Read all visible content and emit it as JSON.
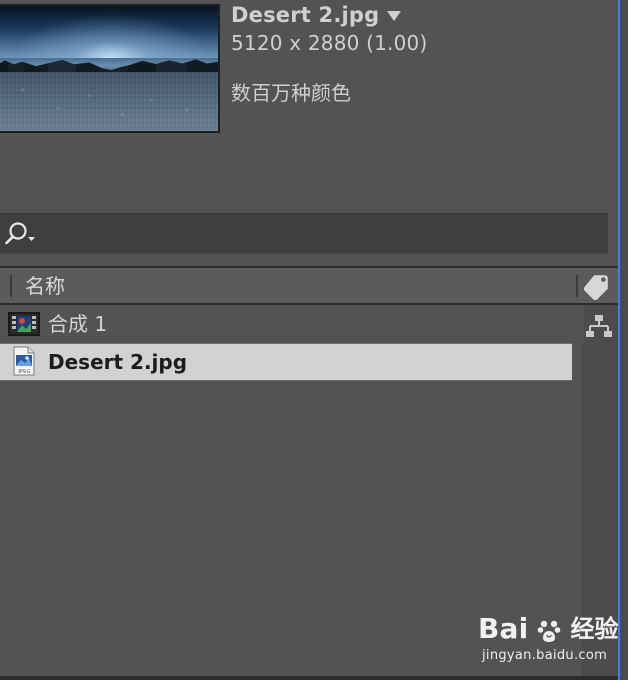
{
  "item": {
    "title": "Desert 2.jpg",
    "dimensions": "5120 x 2880 (1.00)",
    "color_depth": "数百万种颜色"
  },
  "search": {
    "value": "",
    "placeholder": ""
  },
  "columns": {
    "name": "名称"
  },
  "items": [
    {
      "label": "合成 1",
      "type": "composition",
      "selected": false
    },
    {
      "label": "Desert 2.jpg",
      "type": "jpeg",
      "selected": true
    }
  ],
  "watermark": {
    "brand": "Bai",
    "brand_suffix": "经验",
    "url": "jingyan.baidu.com"
  },
  "colors": {
    "panel_bg": "#535353",
    "search_bg": "#3f3f3f",
    "selected_row_bg": "#d2d2d2",
    "accent_edge": "#3a7cff"
  },
  "icons": {
    "thumbnail": "image-thumbnail",
    "search": "search-icon",
    "tag": "tag-icon",
    "composition": "composition-icon",
    "jpeg": "jpeg-file-icon",
    "flowchart": "flowchart-icon",
    "paw": "paw-icon"
  }
}
